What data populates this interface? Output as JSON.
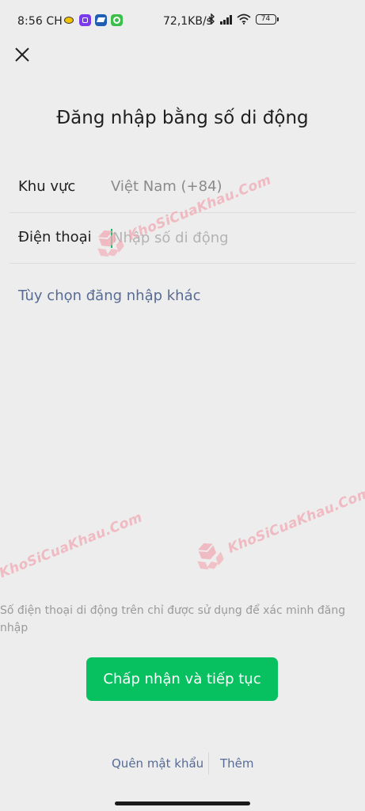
{
  "status_bar": {
    "time": "8:56 CH",
    "network_speed": "72,1KB/s",
    "battery": "74",
    "app_icons": [
      "bee-app-icon",
      "purple-app-icon",
      "blue-app-icon",
      "green-app-icon"
    ]
  },
  "header": {
    "close_icon": "close-icon",
    "title": "Đăng nhập bằng số di động"
  },
  "form": {
    "region_label": "Khu vực",
    "region_value": "Việt Nam (+84)",
    "phone_label": "Điện thoại",
    "phone_placeholder": "Nhập số di động",
    "phone_value": ""
  },
  "other_login": "Tùy chọn đăng nhập khác",
  "disclaimer": "Số điện thoại di động trên chỉ được sử dụng để xác minh đăng nhập",
  "accept_button": "Chấp nhận và tiếp tục",
  "bottom_links": {
    "forgot_password": "Quên mật khẩu",
    "more": "Thêm"
  },
  "watermark": {
    "text": "KhoSiCuaKhau.Com"
  },
  "colors": {
    "accent_green": "#07c160",
    "link_blue": "#576b95",
    "background": "#ededed",
    "watermark_pink": "#f2a9b4"
  }
}
